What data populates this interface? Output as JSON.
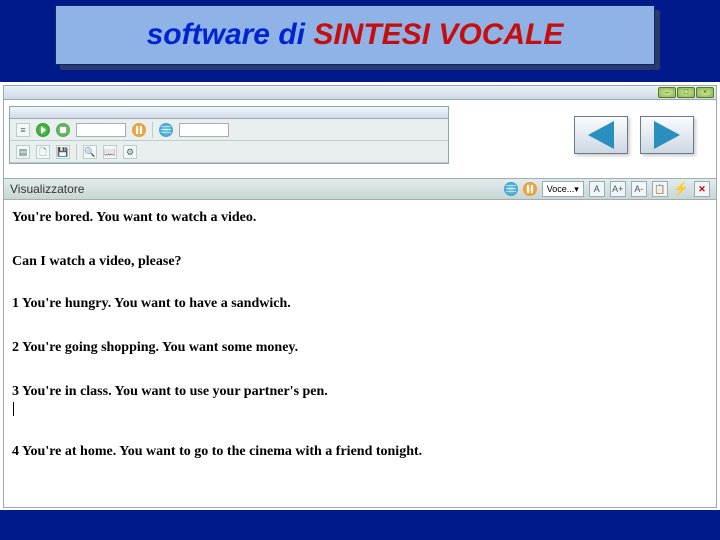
{
  "slide": {
    "title_part1": "software di ",
    "title_part2": "SINTESI VOCALE"
  },
  "app": {
    "inner_title": "",
    "toolbar1_field1": "",
    "toolbar1_field2": "",
    "viewer_label": "Visualizzatore",
    "voice_dropdown": "Voce..."
  },
  "nav": {
    "prev": "Previous",
    "next": "Next"
  },
  "document": {
    "lines": [
      "You're bored. You want to watch a video.",
      "Can I watch a video, please?",
      "1 You're hungry. You want to have a sandwich.",
      "2 You're going shopping. You want some money.",
      "3 You're in class. You want to use your partner's pen.",
      "4 You're at home. You want to go to the cinema with a friend tonight."
    ]
  }
}
